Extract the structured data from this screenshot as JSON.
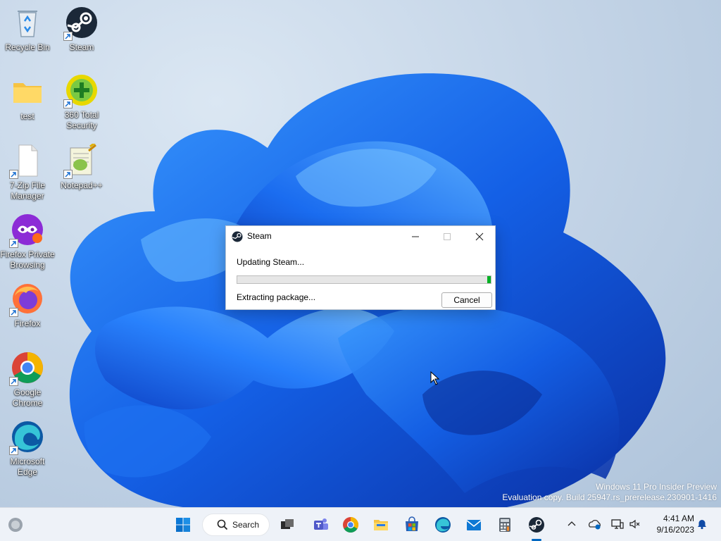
{
  "desktop": {
    "icons": [
      {
        "label": "Recycle Bin",
        "icon": "recycle-bin-icon",
        "shortcut": false
      },
      {
        "label": "Steam",
        "icon": "steam-icon",
        "shortcut": true
      },
      {
        "label": "test",
        "icon": "folder-icon",
        "shortcut": false
      },
      {
        "label": "360 Total\nSecurity",
        "icon": "360-total-security-icon",
        "shortcut": true
      },
      {
        "label": "7-Zip File\nManager",
        "icon": "7zip-file-icon",
        "shortcut": true
      },
      {
        "label": "Notepad++",
        "icon": "notepad-plus-plus-icon",
        "shortcut": true
      },
      {
        "label": "Firefox Private\nBrowsing",
        "icon": "firefox-private-icon",
        "shortcut": true
      },
      {
        "label": "Firefox",
        "icon": "firefox-icon",
        "shortcut": true
      },
      {
        "label": "Google\nChrome",
        "icon": "chrome-icon",
        "shortcut": true
      },
      {
        "label": "Microsoft\nEdge",
        "icon": "edge-icon",
        "shortcut": true
      }
    ],
    "watermark": {
      "line1": "Windows 11 Pro Insider Preview",
      "line2": "Evaluation copy. Build 25947.rs_prerelease.230901-1416"
    }
  },
  "dialog": {
    "title": "Steam",
    "message": "Updating Steam...",
    "status": "Extracting package...",
    "cancel_label": "Cancel",
    "progress_fraction": 0.015,
    "progress_color": "#06b025"
  },
  "taskbar": {
    "search_label": "Search",
    "clock_time": "4:41 AM",
    "clock_date": "9/16/2023",
    "pinned": [
      "start-icon",
      "task-view-icon",
      "teams-icon",
      "chrome-icon",
      "file-explorer-icon",
      "microsoft-store-icon",
      "edge-icon",
      "mail-icon",
      "calculator-icon",
      "steam-icon"
    ],
    "tray": [
      "show-hidden-icons-chevron",
      "onedrive-icon",
      "network-icon",
      "volume-muted-icon",
      "notification-bell-icon"
    ]
  },
  "colors": {
    "accent": "#0067c0",
    "wallpaper_blue": "#1565e8"
  }
}
